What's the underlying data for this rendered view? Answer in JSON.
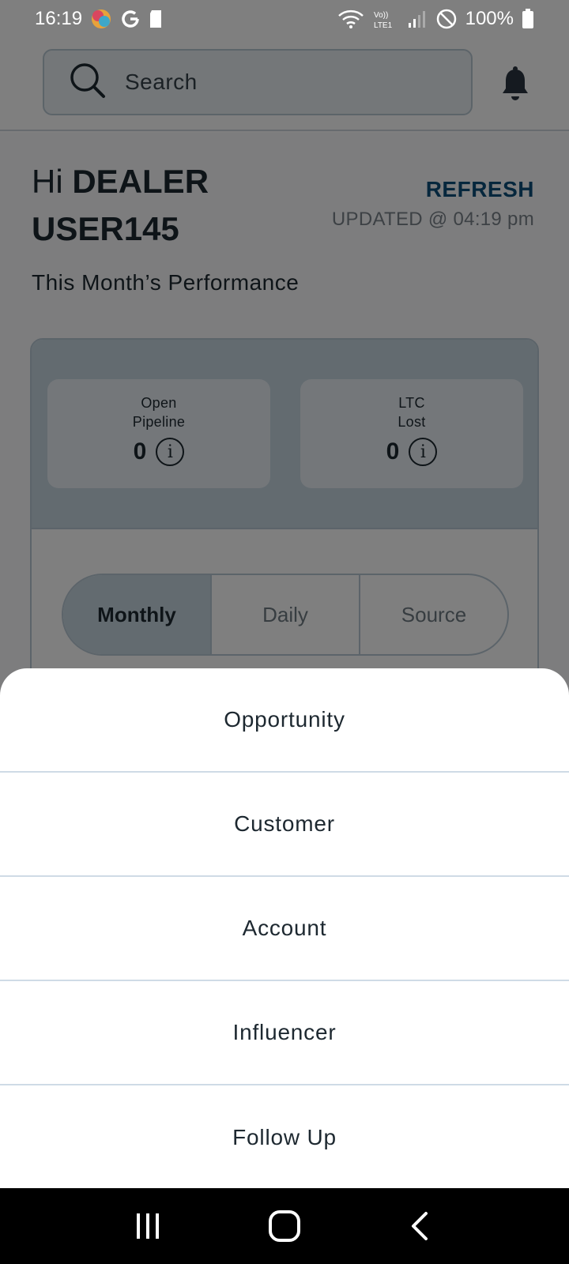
{
  "status_bar": {
    "time": "16:19",
    "battery": "100%",
    "icons": [
      "photos-icon",
      "google-icon",
      "sd-card-icon",
      "wifi-icon",
      "volte-lte-icon",
      "signal-icon",
      "do-not-disturb-icon",
      "battery-icon"
    ]
  },
  "header": {
    "search_placeholder": "Search",
    "bell_icon": "bell-icon"
  },
  "greeting": {
    "prefix": "Hi ",
    "name_line1": "DEALER",
    "name_line2": "USER145"
  },
  "refresh": {
    "label": "REFRESH",
    "updated": "UPDATED @ 04:19 pm"
  },
  "performance": {
    "title": "This Month’s Performance",
    "metrics": [
      {
        "label_line1": "Open",
        "label_line2": "Pipeline",
        "value": "0",
        "info": "i"
      },
      {
        "label_line1": "LTC",
        "label_line2": "Lost",
        "value": "0",
        "info": "i"
      }
    ],
    "segments": [
      {
        "label": "Monthly",
        "active": true
      },
      {
        "label": "Daily",
        "active": false
      },
      {
        "label": "Source",
        "active": false
      }
    ]
  },
  "bottom_sheet": {
    "items": [
      "Opportunity",
      "Customer",
      "Account",
      "Influencer",
      "Follow Up"
    ]
  },
  "nav_bar": {
    "buttons": [
      "recent-apps-icon",
      "home-icon",
      "back-icon"
    ]
  },
  "colors": {
    "accent": "#0d4f7a",
    "panel": "#c6d6e1",
    "overlay": "rgba(0,0,0,0.5)"
  }
}
